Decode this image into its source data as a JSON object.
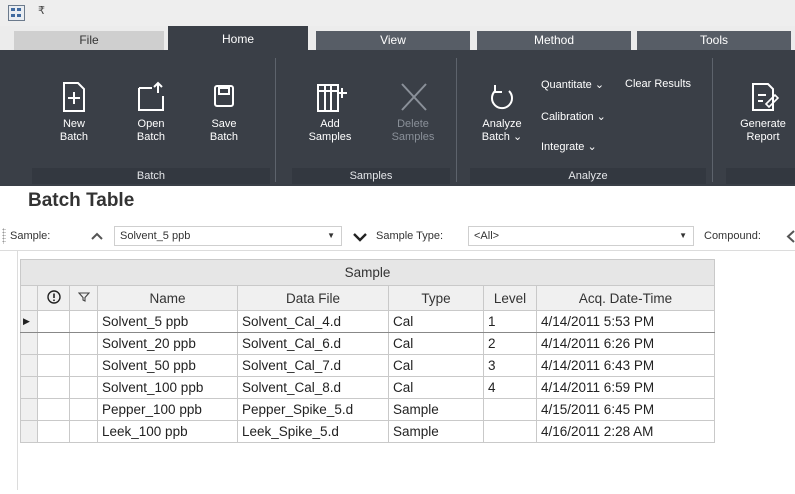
{
  "quick_access": "₹",
  "tabs": [
    "File",
    "Home",
    "View",
    "Method",
    "Tools"
  ],
  "ribbon": {
    "new_batch": "New\nBatch",
    "open_batch": "Open\nBatch",
    "save_batch": "Save\nBatch",
    "add_samples": "Add\nSamples",
    "delete_samples": "Delete\nSamples",
    "analyze_batch": "Analyze\nBatch ⌄",
    "quantitate": "Quantitate ⌄",
    "clear_results": "Clear Results",
    "calibration": "Calibration ⌄",
    "integrate": "Integrate ⌄",
    "generate_report": "Generate\nReport",
    "groups": [
      "Batch",
      "Samples",
      "Analyze"
    ]
  },
  "batch_table": {
    "title": "Batch Table",
    "filter": {
      "sample_label": "Sample:",
      "sample_value": "Solvent_5 ppb",
      "sample_type_label": "Sample Type:",
      "sample_type_value": "<All>",
      "compound_label": "Compound:"
    },
    "group_header": "Sample",
    "columns": [
      "Name",
      "Data File",
      "Type",
      "Level",
      "Acq. Date-Time"
    ],
    "rows": [
      {
        "name": "Solvent_5 ppb",
        "data_file": "Solvent_Cal_4.d",
        "type": "Cal",
        "level": "1",
        "acq": "4/14/2011 5:53 PM"
      },
      {
        "name": "Solvent_20 ppb",
        "data_file": "Solvent_Cal_6.d",
        "type": "Cal",
        "level": "2",
        "acq": "4/14/2011 6:26 PM"
      },
      {
        "name": "Solvent_50 ppb",
        "data_file": "Solvent_Cal_7.d",
        "type": "Cal",
        "level": "3",
        "acq": "4/14/2011 6:43 PM"
      },
      {
        "name": "Solvent_100 ppb",
        "data_file": "Solvent_Cal_8.d",
        "type": "Cal",
        "level": "4",
        "acq": "4/14/2011 6:59 PM"
      },
      {
        "name": "Pepper_100 ppb",
        "data_file": "Pepper_Spike_5.d",
        "type": "Sample",
        "level": "",
        "acq": "4/15/2011 6:45 PM"
      },
      {
        "name": "Leek_100 ppb",
        "data_file": "Leek_Spike_5.d",
        "type": "Sample",
        "level": "",
        "acq": "4/16/2011 2:28 AM"
      }
    ]
  },
  "colors": {
    "ribbon_bg": "#3a3f47",
    "tab_bg": "#575d66",
    "grid_border": "#c9c9c9"
  }
}
